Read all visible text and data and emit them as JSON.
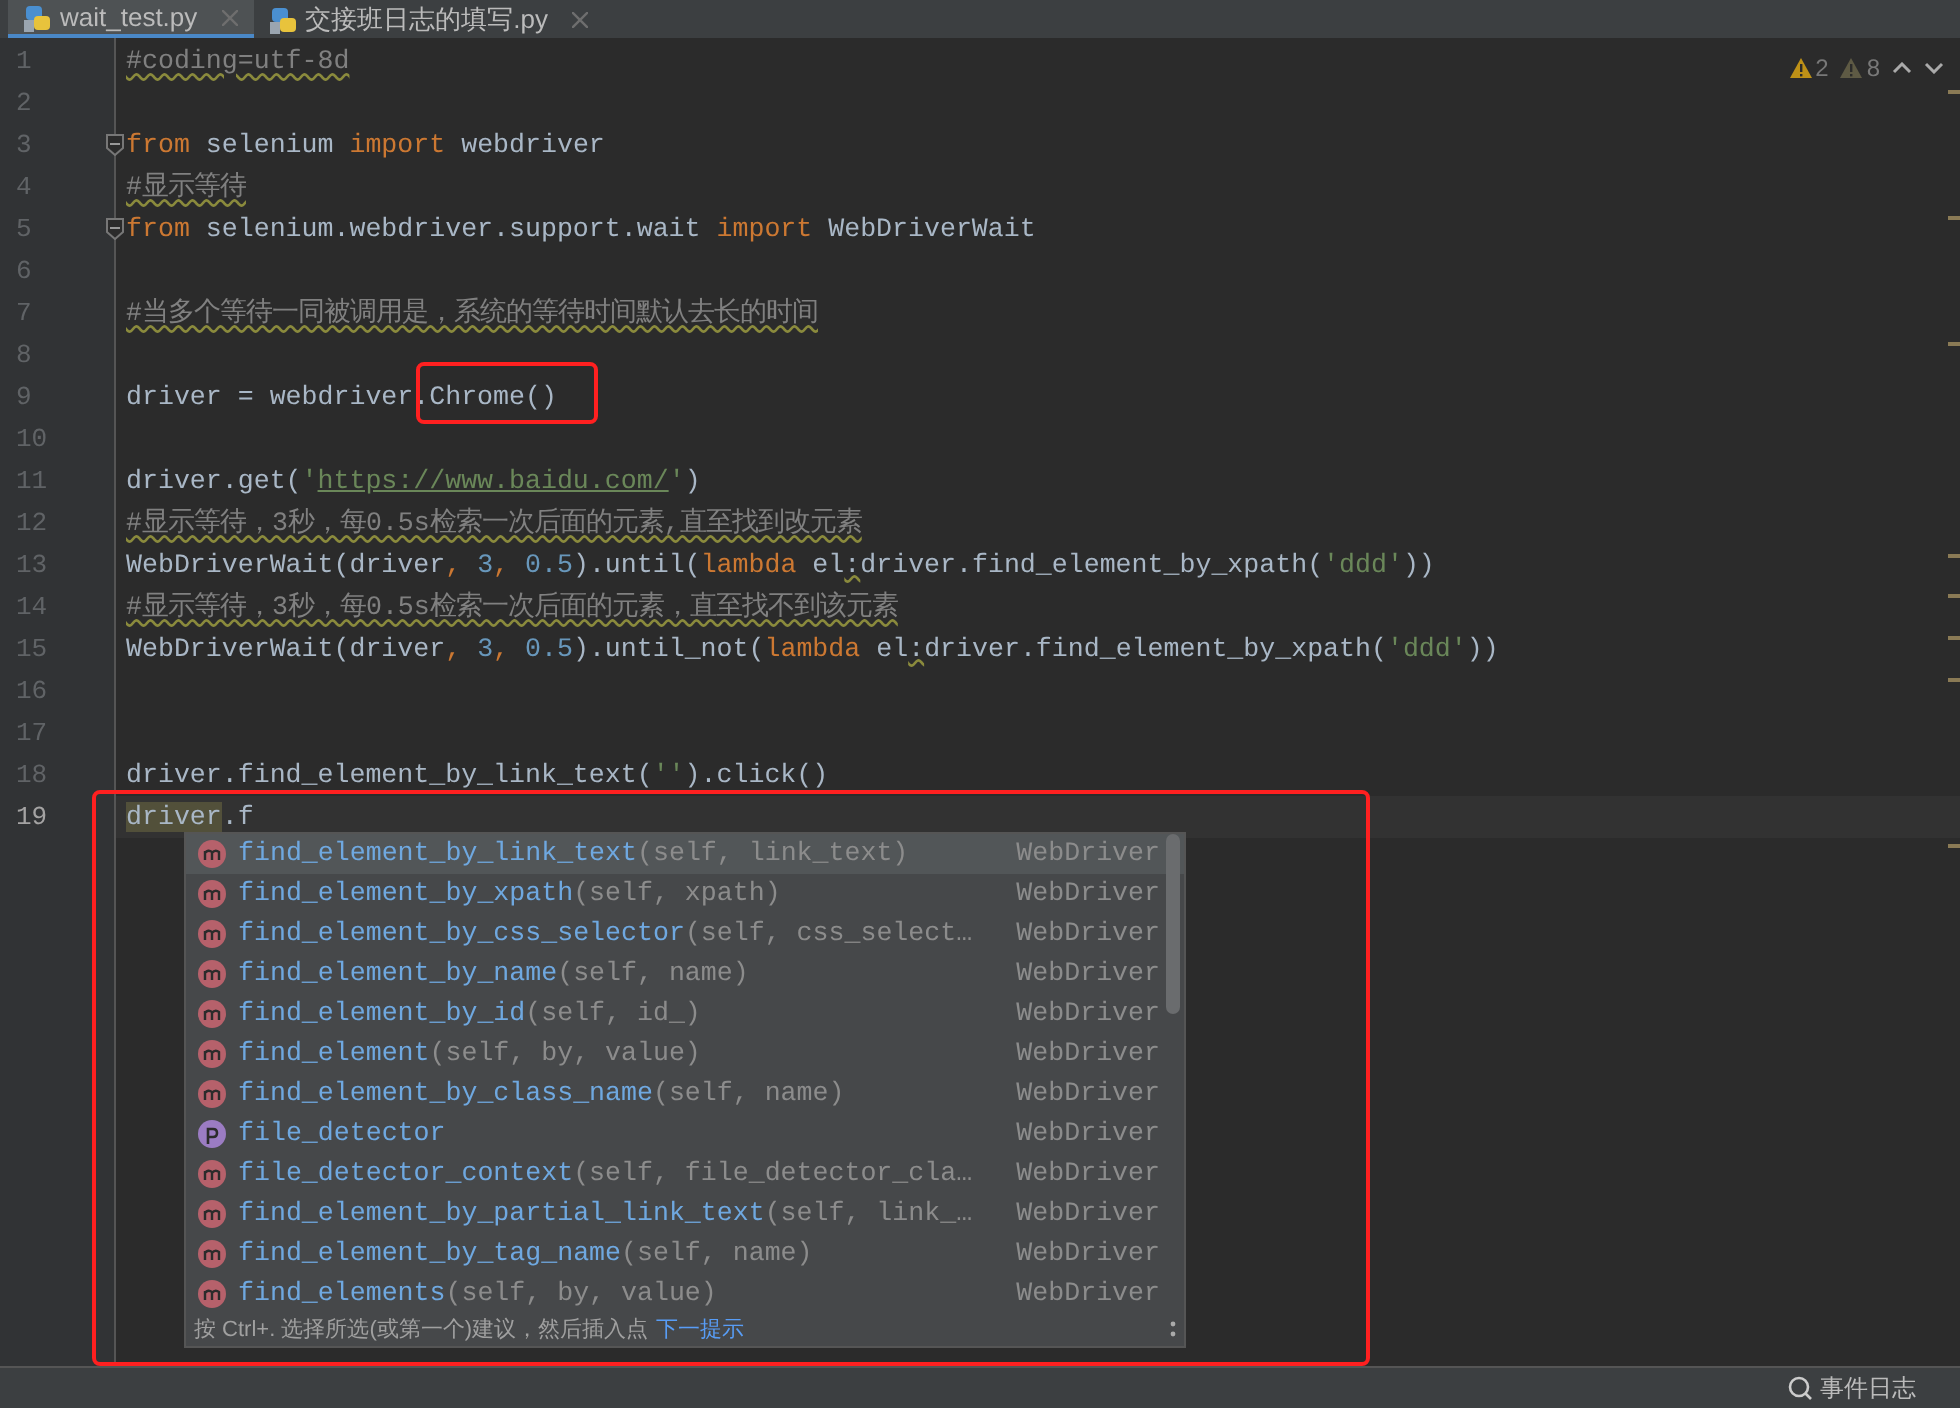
{
  "tabs": [
    {
      "label": "wait_test.py",
      "selected": true
    },
    {
      "label": "交接班日志的填写.py",
      "selected": false
    }
  ],
  "inspections": [
    {
      "kind": "warning",
      "count": "2"
    },
    {
      "kind": "weak",
      "count": "8"
    }
  ],
  "lines": [
    {
      "number": "1",
      "current": false,
      "tokens": [
        {
          "kind": "comment",
          "text": "#coding=utf-8d"
        }
      ]
    },
    {
      "number": "2",
      "current": false
    },
    {
      "number": "3",
      "current": false,
      "fold": true,
      "tokens": [
        {
          "kind": "keyword",
          "text": "from"
        },
        {
          "kind": "plain",
          "text": " selenium "
        },
        {
          "kind": "keyword",
          "text": "import"
        },
        {
          "kind": "plain",
          "text": " webdriver"
        }
      ]
    },
    {
      "number": "4",
      "current": false,
      "tokens": [
        {
          "kind": "comment",
          "text": "#显示等待"
        }
      ]
    },
    {
      "number": "5",
      "current": false,
      "fold": true,
      "tokens": [
        {
          "kind": "keyword",
          "text": "from"
        },
        {
          "kind": "plain",
          "text": " selenium.webdriver.support.wait "
        },
        {
          "kind": "keyword",
          "text": "import"
        },
        {
          "kind": "plain",
          "text": " WebDriverWait"
        }
      ]
    },
    {
      "number": "6",
      "current": false
    },
    {
      "number": "7",
      "current": false,
      "tokens": [
        {
          "kind": "comment",
          "text": "#当多个等待一同被调用是，系统的等待时间默认去长的时间"
        }
      ]
    },
    {
      "number": "8",
      "current": false
    },
    {
      "number": "9",
      "current": false,
      "tokens": [
        {
          "kind": "plain",
          "text": "driver = webdriver.Chrome()"
        }
      ]
    },
    {
      "number": "10",
      "current": false
    },
    {
      "number": "11",
      "current": false,
      "tokens": [
        {
          "kind": "plain",
          "text": "driver.get("
        },
        {
          "kind": "string",
          "text": "'"
        },
        {
          "kind": "url",
          "text": "https://www.baidu.com/"
        },
        {
          "kind": "string",
          "text": "'"
        },
        {
          "kind": "plain",
          "text": ")"
        }
      ]
    },
    {
      "number": "12",
      "current": false,
      "tokens": [
        {
          "kind": "comment",
          "text": "#显示等待，3秒，每0.5s检索一次后面的元素,直至找到改元素"
        }
      ]
    },
    {
      "number": "13",
      "current": false,
      "tokens": [
        {
          "kind": "plain",
          "text": "WebDriverWait(driver"
        },
        {
          "kind": "keyword",
          "text": ", "
        },
        {
          "kind": "number",
          "text": "3"
        },
        {
          "kind": "keyword",
          "text": ", "
        },
        {
          "kind": "number",
          "text": "0.5"
        },
        {
          "kind": "plain",
          "text": ").until("
        },
        {
          "kind": "keyword",
          "text": "lambda"
        },
        {
          "kind": "plain",
          "text": " el"
        },
        {
          "kind": "squiggle",
          "text": ":"
        },
        {
          "kind": "plain",
          "text": "driver.find_element_by_xpath("
        },
        {
          "kind": "string",
          "text": "'ddd'"
        },
        {
          "kind": "plain",
          "text": "))"
        }
      ]
    },
    {
      "number": "14",
      "current": false,
      "tokens": [
        {
          "kind": "comment",
          "text": "#显示等待，3秒，每0.5s检索一次后面的元素，直至找不到该元素"
        }
      ]
    },
    {
      "number": "15",
      "current": false,
      "tokens": [
        {
          "kind": "plain",
          "text": "WebDriverWait(driver"
        },
        {
          "kind": "keyword",
          "text": ", "
        },
        {
          "kind": "number",
          "text": "3"
        },
        {
          "kind": "keyword",
          "text": ", "
        },
        {
          "kind": "number",
          "text": "0.5"
        },
        {
          "kind": "plain",
          "text": ").until_not("
        },
        {
          "kind": "keyword",
          "text": "lambda"
        },
        {
          "kind": "plain",
          "text": " el"
        },
        {
          "kind": "squiggle",
          "text": ":"
        },
        {
          "kind": "plain",
          "text": "driver.find_element_by_xpath("
        },
        {
          "kind": "string",
          "text": "'ddd'"
        },
        {
          "kind": "plain",
          "text": "))"
        }
      ]
    },
    {
      "number": "16",
      "current": false
    },
    {
      "number": "17",
      "current": false
    },
    {
      "number": "18",
      "current": false,
      "tokens": [
        {
          "kind": "plain",
          "text": "driver.find_element_by_link_text("
        },
        {
          "kind": "string",
          "text": "''"
        },
        {
          "kind": "plain",
          "text": ").click()"
        }
      ]
    },
    {
      "number": "19",
      "current": true,
      "tokens": [
        {
          "kind": "highlight",
          "text": "driver"
        },
        {
          "kind": "plain",
          "text": ".f"
        }
      ]
    }
  ],
  "completion": {
    "items": [
      {
        "kind": "method",
        "name": "find_element_by_link_text",
        "params": "(self, link_text)",
        "type": "WebDriver",
        "selected": true
      },
      {
        "kind": "method",
        "name": "find_element_by_xpath",
        "params": "(self, xpath)",
        "type": "WebDriver",
        "selected": false
      },
      {
        "kind": "method",
        "name": "find_element_by_css_selector",
        "params": "(self, css_select…",
        "type": "WebDriver",
        "selected": false
      },
      {
        "kind": "method",
        "name": "find_element_by_name",
        "params": "(self, name)",
        "type": "WebDriver",
        "selected": false
      },
      {
        "kind": "method",
        "name": "find_element_by_id",
        "params": "(self, id_)",
        "type": "WebDriver",
        "selected": false
      },
      {
        "kind": "method",
        "name": "find_element",
        "params": "(self, by, value)",
        "type": "WebDriver",
        "selected": false
      },
      {
        "kind": "method",
        "name": "find_element_by_class_name",
        "params": "(self, name)",
        "type": "WebDriver",
        "selected": false
      },
      {
        "kind": "property",
        "name": "file_detector",
        "type": "WebDriver",
        "selected": false
      },
      {
        "kind": "method",
        "name": "file_detector_context",
        "params": "(self, file_detector_cla…",
        "type": "WebDriver",
        "selected": false
      },
      {
        "kind": "method",
        "name": "find_element_by_partial_link_text",
        "params": "(self, link_…",
        "type": "WebDriver",
        "selected": false
      },
      {
        "kind": "method",
        "name": "find_element_by_tag_name",
        "params": "(self, name)",
        "type": "WebDriver",
        "selected": false
      },
      {
        "kind": "method",
        "name": "find_elements",
        "params": "(self, by, value)",
        "type": "WebDriver",
        "selected": false
      }
    ],
    "hint": "按 Ctrl+. 选择所选(或第一个)建议，然后插入点",
    "hint_link": "下一提示"
  },
  "status_bar": {
    "event_log": "事件日志"
  }
}
